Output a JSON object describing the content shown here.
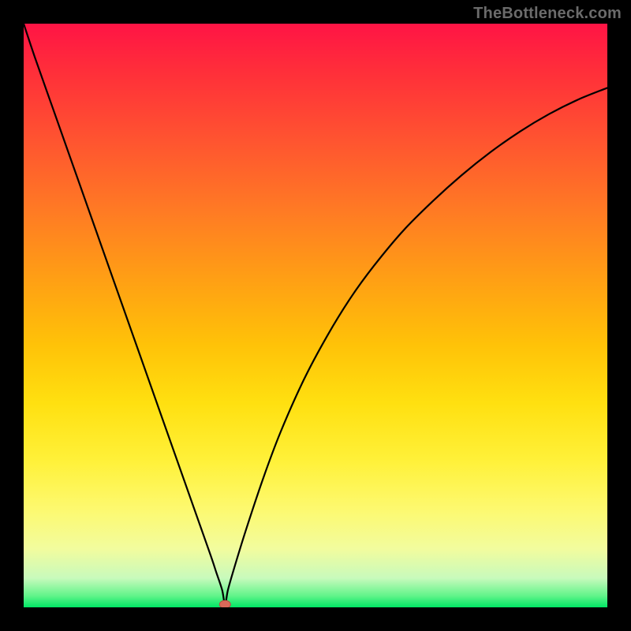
{
  "watermark": "TheBottleneck.com",
  "colors": {
    "frame": "#000000",
    "curve": "#000000",
    "marker_fill": "#d96a5a",
    "marker_stroke": "#b74e40"
  },
  "chart_data": {
    "type": "line",
    "title": "",
    "xlabel": "",
    "ylabel": "",
    "xlim": [
      0,
      100
    ],
    "ylim": [
      0,
      100
    ],
    "x": [
      0,
      2,
      5,
      8,
      11,
      14,
      17,
      20,
      23,
      26,
      29,
      32,
      33,
      34,
      34.5,
      35,
      36,
      38,
      41,
      44,
      48,
      52,
      56,
      60,
      65,
      70,
      75,
      80,
      85,
      90,
      95,
      100
    ],
    "y": [
      100,
      94,
      85.5,
      77,
      68.5,
      60,
      51.5,
      43,
      34.5,
      26,
      17.5,
      9,
      6,
      3,
      0.5,
      3,
      6.5,
      13,
      22,
      30,
      39,
      46.5,
      53,
      58.5,
      64.5,
      69.5,
      74,
      78,
      81.5,
      84.5,
      87,
      89
    ],
    "marker": {
      "x": 34.5,
      "y": 0.5
    },
    "description": "V-shaped bottleneck curve: steep linear descent on the left, minimum near x≈34.5, concave-increasing curve on the right asymptotically approaching ~90."
  }
}
